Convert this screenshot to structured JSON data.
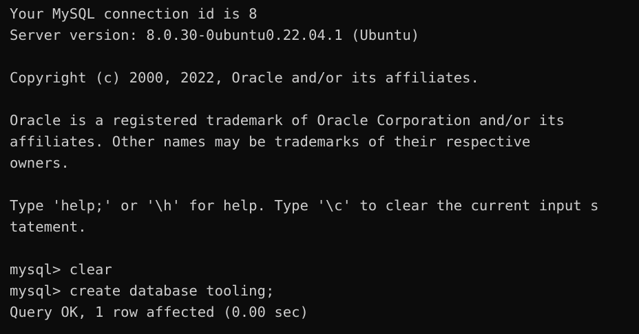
{
  "colors": {
    "background": "#0c0c0c",
    "foreground": "#cccccc"
  },
  "terminal": {
    "lines": [
      "Your MySQL connection id is 8",
      "Server version: 8.0.30-0ubuntu0.22.04.1 (Ubuntu)",
      "",
      "Copyright (c) 2000, 2022, Oracle and/or its affiliates.",
      "",
      "Oracle is a registered trademark of Oracle Corporation and/or its",
      "affiliates. Other names may be trademarks of their respective",
      "owners.",
      "",
      "Type 'help;' or '\\h' for help. Type '\\c' to clear the current input s",
      "tatement.",
      "",
      "mysql> clear",
      "mysql> create database tooling;",
      "Query OK, 1 row affected (0.00 sec)"
    ]
  }
}
